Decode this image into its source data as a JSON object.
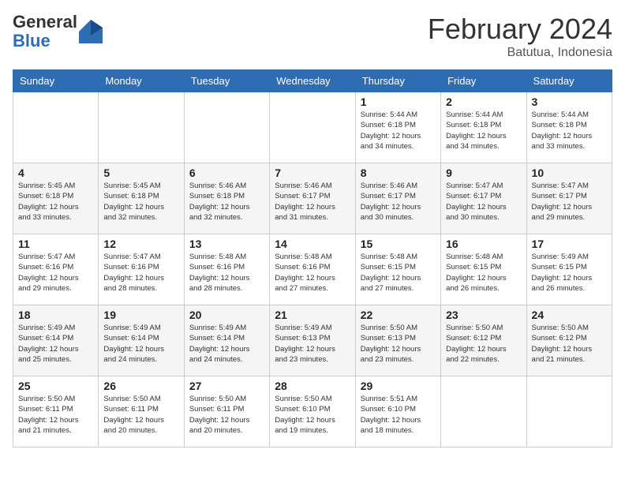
{
  "header": {
    "logo_general": "General",
    "logo_blue": "Blue",
    "month_year": "February 2024",
    "location": "Batutua, Indonesia"
  },
  "weekdays": [
    "Sunday",
    "Monday",
    "Tuesday",
    "Wednesday",
    "Thursday",
    "Friday",
    "Saturday"
  ],
  "weeks": [
    [
      {
        "day": "",
        "info": ""
      },
      {
        "day": "",
        "info": ""
      },
      {
        "day": "",
        "info": ""
      },
      {
        "day": "",
        "info": ""
      },
      {
        "day": "1",
        "info": "Sunrise: 5:44 AM\nSunset: 6:18 PM\nDaylight: 12 hours\nand 34 minutes."
      },
      {
        "day": "2",
        "info": "Sunrise: 5:44 AM\nSunset: 6:18 PM\nDaylight: 12 hours\nand 34 minutes."
      },
      {
        "day": "3",
        "info": "Sunrise: 5:44 AM\nSunset: 6:18 PM\nDaylight: 12 hours\nand 33 minutes."
      }
    ],
    [
      {
        "day": "4",
        "info": "Sunrise: 5:45 AM\nSunset: 6:18 PM\nDaylight: 12 hours\nand 33 minutes."
      },
      {
        "day": "5",
        "info": "Sunrise: 5:45 AM\nSunset: 6:18 PM\nDaylight: 12 hours\nand 32 minutes."
      },
      {
        "day": "6",
        "info": "Sunrise: 5:46 AM\nSunset: 6:18 PM\nDaylight: 12 hours\nand 32 minutes."
      },
      {
        "day": "7",
        "info": "Sunrise: 5:46 AM\nSunset: 6:17 PM\nDaylight: 12 hours\nand 31 minutes."
      },
      {
        "day": "8",
        "info": "Sunrise: 5:46 AM\nSunset: 6:17 PM\nDaylight: 12 hours\nand 30 minutes."
      },
      {
        "day": "9",
        "info": "Sunrise: 5:47 AM\nSunset: 6:17 PM\nDaylight: 12 hours\nand 30 minutes."
      },
      {
        "day": "10",
        "info": "Sunrise: 5:47 AM\nSunset: 6:17 PM\nDaylight: 12 hours\nand 29 minutes."
      }
    ],
    [
      {
        "day": "11",
        "info": "Sunrise: 5:47 AM\nSunset: 6:16 PM\nDaylight: 12 hours\nand 29 minutes."
      },
      {
        "day": "12",
        "info": "Sunrise: 5:47 AM\nSunset: 6:16 PM\nDaylight: 12 hours\nand 28 minutes."
      },
      {
        "day": "13",
        "info": "Sunrise: 5:48 AM\nSunset: 6:16 PM\nDaylight: 12 hours\nand 28 minutes."
      },
      {
        "day": "14",
        "info": "Sunrise: 5:48 AM\nSunset: 6:16 PM\nDaylight: 12 hours\nand 27 minutes."
      },
      {
        "day": "15",
        "info": "Sunrise: 5:48 AM\nSunset: 6:15 PM\nDaylight: 12 hours\nand 27 minutes."
      },
      {
        "day": "16",
        "info": "Sunrise: 5:48 AM\nSunset: 6:15 PM\nDaylight: 12 hours\nand 26 minutes."
      },
      {
        "day": "17",
        "info": "Sunrise: 5:49 AM\nSunset: 6:15 PM\nDaylight: 12 hours\nand 26 minutes."
      }
    ],
    [
      {
        "day": "18",
        "info": "Sunrise: 5:49 AM\nSunset: 6:14 PM\nDaylight: 12 hours\nand 25 minutes."
      },
      {
        "day": "19",
        "info": "Sunrise: 5:49 AM\nSunset: 6:14 PM\nDaylight: 12 hours\nand 24 minutes."
      },
      {
        "day": "20",
        "info": "Sunrise: 5:49 AM\nSunset: 6:14 PM\nDaylight: 12 hours\nand 24 minutes."
      },
      {
        "day": "21",
        "info": "Sunrise: 5:49 AM\nSunset: 6:13 PM\nDaylight: 12 hours\nand 23 minutes."
      },
      {
        "day": "22",
        "info": "Sunrise: 5:50 AM\nSunset: 6:13 PM\nDaylight: 12 hours\nand 23 minutes."
      },
      {
        "day": "23",
        "info": "Sunrise: 5:50 AM\nSunset: 6:12 PM\nDaylight: 12 hours\nand 22 minutes."
      },
      {
        "day": "24",
        "info": "Sunrise: 5:50 AM\nSunset: 6:12 PM\nDaylight: 12 hours\nand 21 minutes."
      }
    ],
    [
      {
        "day": "25",
        "info": "Sunrise: 5:50 AM\nSunset: 6:11 PM\nDaylight: 12 hours\nand 21 minutes."
      },
      {
        "day": "26",
        "info": "Sunrise: 5:50 AM\nSunset: 6:11 PM\nDaylight: 12 hours\nand 20 minutes."
      },
      {
        "day": "27",
        "info": "Sunrise: 5:50 AM\nSunset: 6:11 PM\nDaylight: 12 hours\nand 20 minutes."
      },
      {
        "day": "28",
        "info": "Sunrise: 5:50 AM\nSunset: 6:10 PM\nDaylight: 12 hours\nand 19 minutes."
      },
      {
        "day": "29",
        "info": "Sunrise: 5:51 AM\nSunset: 6:10 PM\nDaylight: 12 hours\nand 18 minutes."
      },
      {
        "day": "",
        "info": ""
      },
      {
        "day": "",
        "info": ""
      }
    ]
  ]
}
